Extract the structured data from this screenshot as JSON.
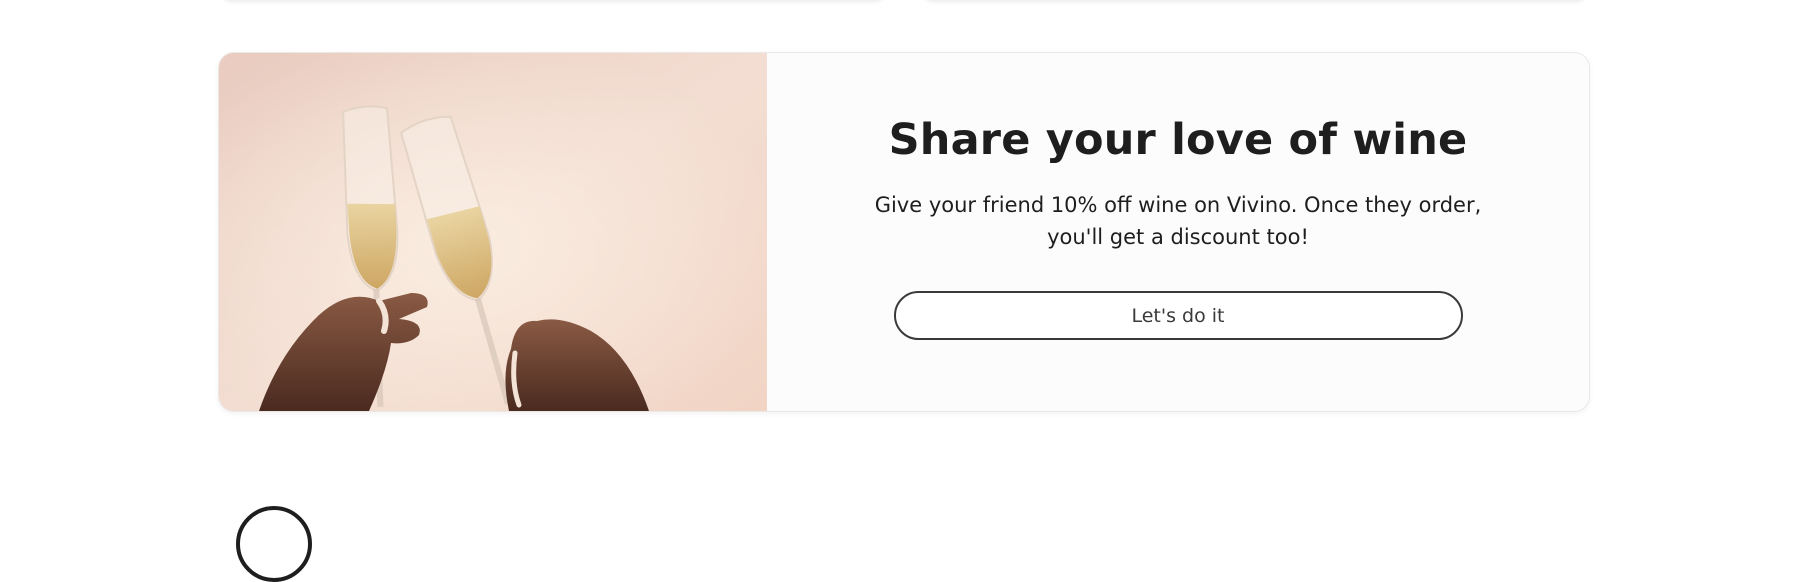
{
  "promo": {
    "title": "Share your love of wine",
    "description": "Give your friend 10% off wine on Vivino. Once they order, you'll get a discount too!",
    "button_label": "Let's do it",
    "image": "champagne-toast-image"
  },
  "colors": {
    "text": "#1e1e1e",
    "button_border": "#3a3a3a",
    "card_background": "#fdfcfc"
  }
}
